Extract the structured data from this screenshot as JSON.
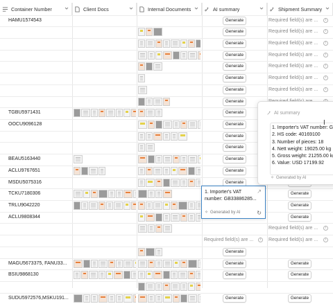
{
  "columns": {
    "container_number": "Container Number",
    "client_docs": "Client Docs",
    "internal_documents": "Internal Documents",
    "ai_summary": "AI summary",
    "shipment_summary": "Shipment Summary"
  },
  "generate_label": "Generate",
  "required_label": "Required field(s) are ...",
  "rows": [
    {
      "container": "HAMU1574543"
    },
    {
      "container": ""
    },
    {
      "container": ""
    },
    {
      "container": ""
    },
    {
      "container": ""
    },
    {
      "container": ""
    },
    {
      "container": ""
    },
    {
      "container": ""
    },
    {
      "container": "TGBU5971431"
    },
    {
      "container": "OOCU9096128"
    },
    {
      "container": ""
    },
    {
      "container": ""
    },
    {
      "container": "BEAU5163440"
    },
    {
      "container": "ACLU9767651"
    },
    {
      "container": "MSDU5075316"
    },
    {
      "container": "TCKU7180306"
    },
    {
      "container": "TRLU9042220"
    },
    {
      "container": "ACLU9808344"
    },
    {
      "container": ""
    },
    {
      "container": ""
    },
    {
      "container": ""
    },
    {
      "container": "MAGU5673375, FANU33..."
    },
    {
      "container": "BSIU9868130"
    },
    {
      "container": ""
    },
    {
      "container": "SUDU5972576,MSKU191..."
    }
  ],
  "ai_popup": {
    "title": "AI summary",
    "lines": [
      "1. Importer's VAT number: GB",
      "2. HS code: 40169100",
      "3. Number of pieces: 18",
      "4. Nett weight: 19025.00 kg",
      "5. Gross weight: 21255.00 kg",
      "6. Value: USD 17199.92"
    ],
    "footer": "Generated by AI"
  },
  "cell_popup": {
    "text": "1. Importer's VAT number: GB33886285...",
    "footer": "Generated by AI"
  }
}
